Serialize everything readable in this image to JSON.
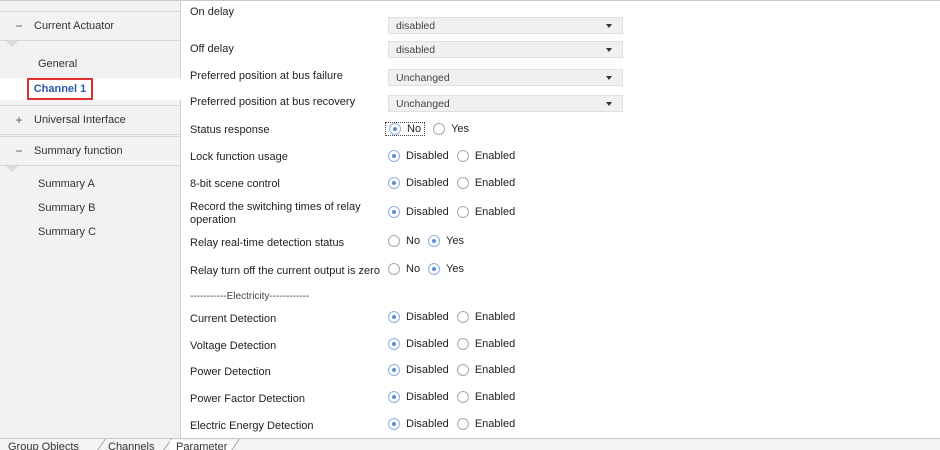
{
  "sidebar": {
    "groups": [
      {
        "sign": "−",
        "label": "Current Actuator"
      },
      {
        "sign": "+",
        "label": "Universal Interface"
      },
      {
        "sign": "−",
        "label": "Summary function"
      }
    ],
    "actuator_items": [
      "General",
      "Channel 1"
    ],
    "selected_item": "Channel 1",
    "summary_items": [
      "Summary A",
      "Summary B",
      "Summary C"
    ]
  },
  "parameters": {
    "on_delay": {
      "label": "On delay",
      "value": "disabled"
    },
    "off_delay": {
      "label": "Off delay",
      "value": "disabled"
    },
    "bus_failure": {
      "label": "Preferred position at bus failure",
      "value": "Unchanged"
    },
    "bus_recovery": {
      "label": "Preferred position at bus recovery",
      "value": "Unchanged"
    },
    "status_response": {
      "label": "Status response",
      "options": [
        "No",
        "Yes"
      ],
      "selected": "No"
    },
    "lock_function": {
      "label": "Lock function usage",
      "options": [
        "Disabled",
        "Enabled"
      ],
      "selected": "Disabled"
    },
    "scene_control": {
      "label": "8-bit scene control",
      "options": [
        "Disabled",
        "Enabled"
      ],
      "selected": "Disabled"
    },
    "switching_times": {
      "label": "Record the switching times of relay operation",
      "options": [
        "Disabled",
        "Enabled"
      ],
      "selected": "Disabled"
    },
    "relay_detection": {
      "label": "Relay real-time detection status",
      "options": [
        "No",
        "Yes"
      ],
      "selected": "Yes"
    },
    "relay_zero": {
      "label": "Relay turn off the current output is zero",
      "options": [
        "No",
        "Yes"
      ],
      "selected": "Yes"
    },
    "electricity_section": "-----------Electricity------------",
    "current_detection": {
      "label": "Current Detection",
      "options": [
        "Disabled",
        "Enabled"
      ],
      "selected": "Disabled"
    },
    "voltage_detection": {
      "label": "Voltage Detection",
      "options": [
        "Disabled",
        "Enabled"
      ],
      "selected": "Disabled"
    },
    "power_detection": {
      "label": "Power Detection",
      "options": [
        "Disabled",
        "Enabled"
      ],
      "selected": "Disabled"
    },
    "power_factor_detection": {
      "label": "Power Factor Detection",
      "options": [
        "Disabled",
        "Enabled"
      ],
      "selected": "Disabled"
    },
    "energy_detection": {
      "label": "Electric Energy Detection",
      "options": [
        "Disabled",
        "Enabled"
      ],
      "selected": "Disabled"
    }
  },
  "tabs": [
    "Group Objects",
    "Channels",
    "Parameter"
  ],
  "active_tab": "Parameter"
}
